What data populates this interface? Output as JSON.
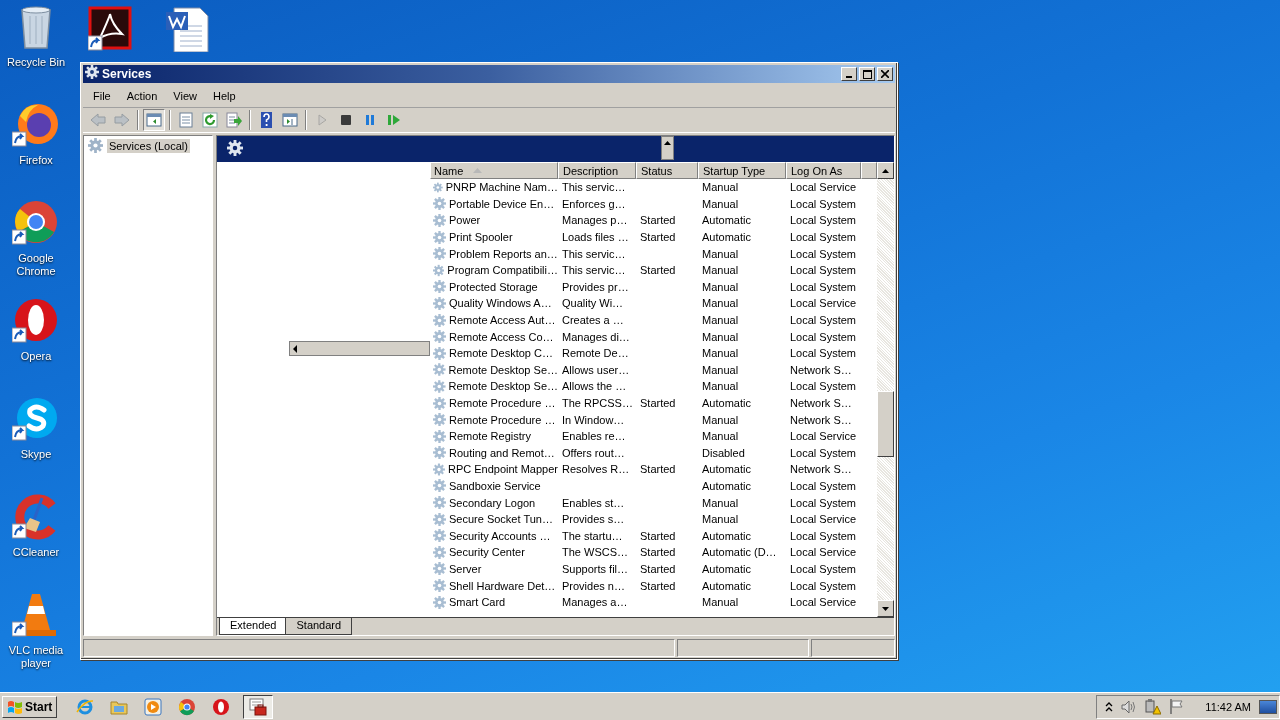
{
  "desktop_icons": [
    {
      "kind": "recycle",
      "label": "Recycle Bin"
    },
    {
      "kind": "firefox",
      "label": "Firefox"
    },
    {
      "kind": "chrome",
      "label": "Google Chrome"
    },
    {
      "kind": "opera",
      "label": "Opera"
    },
    {
      "kind": "skype",
      "label": "Skype"
    },
    {
      "kind": "ccleaner",
      "label": "CCleaner"
    },
    {
      "kind": "vlc",
      "label": "VLC media player"
    }
  ],
  "desktop_top_icons": [
    {
      "kind": "acrobat"
    },
    {
      "kind": "word"
    }
  ],
  "window": {
    "title": "Services",
    "menu": [
      "File",
      "Action",
      "View",
      "Help"
    ],
    "toolbar": [
      {
        "kind": "back",
        "disabled": true
      },
      {
        "kind": "forward",
        "disabled": true
      },
      {
        "kind": "tree",
        "disabled": false
      },
      {
        "kind": "properties",
        "disabled": false
      },
      {
        "kind": "refresh",
        "disabled": false
      },
      {
        "kind": "export",
        "disabled": false
      },
      {
        "kind": "help",
        "disabled": false
      },
      {
        "kind": "actionpane",
        "disabled": false
      },
      {
        "kind": "start",
        "disabled": true
      },
      {
        "kind": "stop",
        "disabled": false
      },
      {
        "kind": "pause",
        "disabled": false
      },
      {
        "kind": "resume",
        "disabled": false
      }
    ],
    "tree": [
      {
        "label": "Services (Local)",
        "selected": true
      }
    ],
    "table": {
      "columns": [
        {
          "label": "Name",
          "sorted": true
        },
        {
          "label": "Description",
          "sorted": false
        },
        {
          "label": "Status",
          "sorted": false
        },
        {
          "label": "Startup Type",
          "sorted": false
        },
        {
          "label": "Log On As",
          "sorted": false
        }
      ],
      "rows": [
        {
          "name": "PNRP Machine Nam…",
          "description": "This servic…",
          "startup_type": "Manual",
          "log_on_as": "Local Service"
        },
        {
          "name": "Portable Device En…",
          "description": "Enforces g…",
          "startup_type": "Manual",
          "log_on_as": "Local System"
        },
        {
          "name": "Power",
          "description": "Manages p…",
          "status": "Started",
          "startup_type": "Automatic",
          "log_on_as": "Local System"
        },
        {
          "name": "Print Spooler",
          "description": "Loads files …",
          "status": "Started",
          "startup_type": "Automatic",
          "log_on_as": "Local System"
        },
        {
          "name": "Problem Reports an…",
          "description": "This servic…",
          "startup_type": "Manual",
          "log_on_as": "Local System"
        },
        {
          "name": "Program Compatibili…",
          "description": "This servic…",
          "status": "Started",
          "startup_type": "Manual",
          "log_on_as": "Local System"
        },
        {
          "name": "Protected Storage",
          "description": "Provides pr…",
          "startup_type": "Manual",
          "log_on_as": "Local System"
        },
        {
          "name": "Quality Windows A…",
          "description": "Quality Wi…",
          "startup_type": "Manual",
          "log_on_as": "Local Service"
        },
        {
          "name": "Remote Access Aut…",
          "description": "Creates a …",
          "startup_type": "Manual",
          "log_on_as": "Local System"
        },
        {
          "name": "Remote Access Co…",
          "description": "Manages di…",
          "startup_type": "Manual",
          "log_on_as": "Local System"
        },
        {
          "name": "Remote Desktop C…",
          "description": "Remote De…",
          "startup_type": "Manual",
          "log_on_as": "Local System"
        },
        {
          "name": "Remote Desktop Se…",
          "description": "Allows user…",
          "startup_type": "Manual",
          "log_on_as": "Network S…"
        },
        {
          "name": "Remote Desktop Se…",
          "description": "Allows the …",
          "startup_type": "Manual",
          "log_on_as": "Local System"
        },
        {
          "name": "Remote Procedure …",
          "description": "The RPCSS…",
          "status": "Started",
          "startup_type": "Automatic",
          "log_on_as": "Network S…"
        },
        {
          "name": "Remote Procedure …",
          "description": "In Window…",
          "startup_type": "Manual",
          "log_on_as": "Network S…"
        },
        {
          "name": "Remote Registry",
          "description": "Enables re…",
          "startup_type": "Manual",
          "log_on_as": "Local Service"
        },
        {
          "name": "Routing and Remot…",
          "description": "Offers rout…",
          "startup_type": "Disabled",
          "log_on_as": "Local System"
        },
        {
          "name": "RPC Endpoint Mapper",
          "description": "Resolves R…",
          "status": "Started",
          "startup_type": "Automatic",
          "log_on_as": "Network S…"
        },
        {
          "name": "Sandboxie Service",
          "startup_type": "Automatic",
          "log_on_as": "Local System"
        },
        {
          "name": "Secondary Logon",
          "description": "Enables st…",
          "startup_type": "Manual",
          "log_on_as": "Local System"
        },
        {
          "name": "Secure Socket Tun…",
          "description": "Provides s…",
          "startup_type": "Manual",
          "log_on_as": "Local Service"
        },
        {
          "name": "Security Accounts …",
          "description": "The startu…",
          "status": "Started",
          "startup_type": "Automatic",
          "log_on_as": "Local System"
        },
        {
          "name": "Security Center",
          "description": "The WSCS…",
          "status": "Started",
          "startup_type": "Automatic (D…",
          "log_on_as": "Local Service"
        },
        {
          "name": "Server",
          "description": "Supports fil…",
          "status": "Started",
          "startup_type": "Automatic",
          "log_on_as": "Local System"
        },
        {
          "name": "Shell Hardware Det…",
          "description": "Provides n…",
          "status": "Started",
          "startup_type": "Automatic",
          "log_on_as": "Local System"
        },
        {
          "name": "Smart Card",
          "description": "Manages a…",
          "startup_type": "Manual",
          "log_on_as": "Local Service"
        }
      ]
    },
    "tabs": [
      {
        "label": "Extended",
        "selected": true
      },
      {
        "label": "Standard",
        "selected": false
      }
    ]
  },
  "taskbar": {
    "start": "Start",
    "apps": [
      {
        "kind": "ie",
        "active": false
      },
      {
        "kind": "explorer",
        "active": false
      },
      {
        "kind": "media",
        "active": false
      },
      {
        "kind": "chrome",
        "active": false
      },
      {
        "kind": "opera",
        "active": false
      },
      {
        "kind": "services",
        "active": true
      }
    ],
    "tray": {
      "clock": "11:42 AM"
    }
  }
}
